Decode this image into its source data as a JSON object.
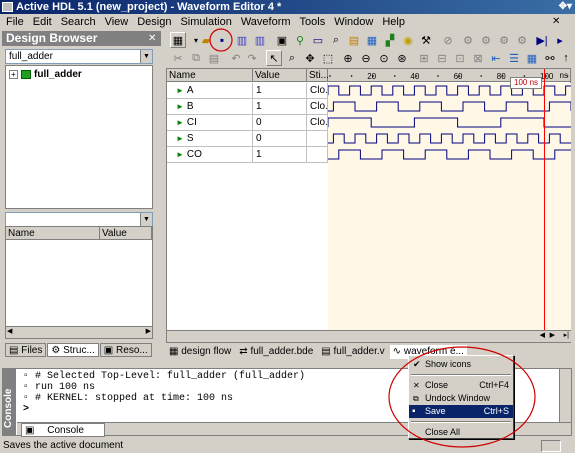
{
  "window": {
    "title": "Active HDL 5.1 (new_project) - Waveform Editor 4 *"
  },
  "menu": [
    "File",
    "Edit",
    "Search",
    "View",
    "Design",
    "Simulation",
    "Waveform",
    "Tools",
    "Window",
    "Help"
  ],
  "design_browser": {
    "title": "Design Browser",
    "selected_unit": "full_adder",
    "tree_items": [
      {
        "label": "full_adder"
      }
    ],
    "props_columns": [
      "Name",
      "Value"
    ],
    "tabs": [
      "Files",
      "Struc...",
      "Reso..."
    ]
  },
  "waveform": {
    "columns": [
      "Name",
      "Value",
      "Sti..."
    ],
    "signals": [
      {
        "name": "A",
        "value": "1",
        "stimulus": "Clo..."
      },
      {
        "name": "B",
        "value": "1",
        "stimulus": "Clo..."
      },
      {
        "name": "CI",
        "value": "0",
        "stimulus": "Clo..."
      },
      {
        "name": "S",
        "value": "0",
        "stimulus": ""
      },
      {
        "name": "CO",
        "value": "1",
        "stimulus": ""
      }
    ],
    "time_ticks": [
      "20",
      "40",
      "60",
      "80",
      "100"
    ],
    "time_unit": "ns",
    "cursor_label": "100 ns"
  },
  "editor_tabs": [
    "design flow",
    "full_adder.bde",
    "full_adder.v",
    "waveform e..."
  ],
  "console": {
    "label": "Console",
    "lines": [
      "# Selected Top-Level: full_adder (full_adder)",
      "run 100 ns",
      "# KERNEL: stopped at time: 100 ns"
    ],
    "prompt": ">"
  },
  "context_menu": {
    "items": [
      {
        "label": "Show icons",
        "shortcut": "",
        "checked": true
      },
      {
        "label": "Close",
        "shortcut": "Ctrl+F4"
      },
      {
        "label": "Undock Window",
        "shortcut": ""
      },
      {
        "label": "Save",
        "shortcut": "Ctrl+S",
        "selected": true
      },
      {
        "label": "Close All",
        "shortcut": ""
      }
    ]
  },
  "status": {
    "text": "Saves the active document"
  },
  "colors": {
    "titlebar": "#0a246a",
    "highlight": "#d00000",
    "wave": "#000080",
    "cursor": "#ff0000"
  }
}
